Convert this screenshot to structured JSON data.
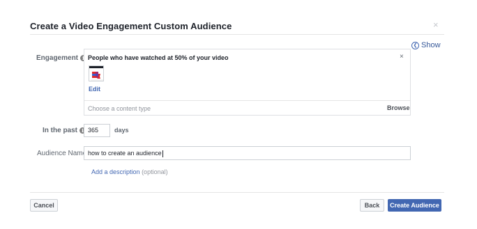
{
  "dialog": {
    "title": "Create a Video Engagement Custom Audience",
    "close_glyph": "×",
    "show_label": "Show"
  },
  "engagement": {
    "label": "Engagement",
    "selected": "People who have watched at 50% of your video",
    "remove_glyph": "×",
    "edit_label": "Edit",
    "content_placeholder": "Choose a content type",
    "browse_label": "Browse"
  },
  "retention": {
    "label": "In the past",
    "days_value": "365",
    "days_unit": "days"
  },
  "audience_name": {
    "label": "Audience Name",
    "value": "how to create an audience",
    "add_description": "Add a description",
    "optional": "(optional)"
  },
  "footer": {
    "cancel_label": "Cancel",
    "back_label": "Back",
    "create_label": "Create Audience"
  },
  "colors": {
    "primary_blue": "#4267b2",
    "link_blue": "#365899",
    "text_dark": "#1d2129",
    "muted": "#90949c"
  }
}
